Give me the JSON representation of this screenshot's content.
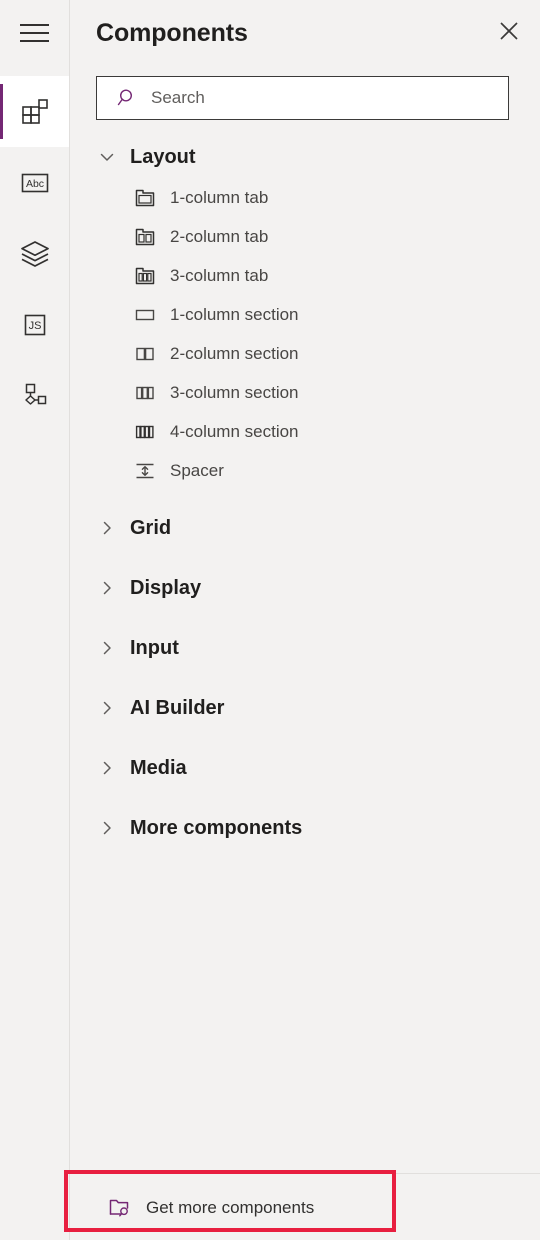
{
  "rail": {
    "menu": {
      "icon": "hamburger-menu-icon",
      "label": "Menu"
    },
    "items": [
      {
        "icon": "components-icon",
        "label": "Components",
        "active": true
      },
      {
        "icon": "text-abc-icon",
        "label": "Abc",
        "active": false
      },
      {
        "icon": "layers-icon",
        "label": "Layers",
        "active": false
      },
      {
        "icon": "javascript-js-icon",
        "label": "JS",
        "active": false
      },
      {
        "icon": "flow-tree-icon",
        "label": "Flow",
        "active": false
      }
    ]
  },
  "panel": {
    "title": "Components",
    "close_icon": "close-icon",
    "close_label": "Close"
  },
  "search": {
    "placeholder": "Search",
    "value": "",
    "icon": "search-icon"
  },
  "tree": {
    "groups": [
      {
        "label": "Layout",
        "expanded": true,
        "chevron": "chevron-down-icon",
        "items": [
          {
            "label": "1-column tab",
            "icon": "tab-1-column-icon"
          },
          {
            "label": "2-column tab",
            "icon": "tab-2-column-icon"
          },
          {
            "label": "3-column tab",
            "icon": "tab-3-column-icon"
          },
          {
            "label": "1-column section",
            "icon": "section-1-column-icon"
          },
          {
            "label": "2-column section",
            "icon": "section-2-column-icon"
          },
          {
            "label": "3-column section",
            "icon": "section-3-column-icon"
          },
          {
            "label": "4-column section",
            "icon": "section-4-column-icon"
          },
          {
            "label": "Spacer",
            "icon": "spacer-icon"
          }
        ]
      },
      {
        "label": "Grid",
        "expanded": false,
        "chevron": "chevron-right-icon",
        "items": []
      },
      {
        "label": "Display",
        "expanded": false,
        "chevron": "chevron-right-icon",
        "items": []
      },
      {
        "label": "Input",
        "expanded": false,
        "chevron": "chevron-right-icon",
        "items": []
      },
      {
        "label": "AI Builder",
        "expanded": false,
        "chevron": "chevron-right-icon",
        "items": []
      },
      {
        "label": "Media",
        "expanded": false,
        "chevron": "chevron-right-icon",
        "items": []
      },
      {
        "label": "More components",
        "expanded": false,
        "chevron": "chevron-right-icon",
        "items": []
      }
    ]
  },
  "footer": {
    "get_more_label": "Get more components",
    "get_more_icon": "folder-search-icon"
  },
  "colors": {
    "accent_purple": "#742774",
    "highlight_red": "#e81f40",
    "panel_background": "#f3f2f1",
    "active_background": "#ffffff",
    "text_primary": "#201f1e",
    "text_secondary": "#484644",
    "divider": "#e1dfdd"
  }
}
